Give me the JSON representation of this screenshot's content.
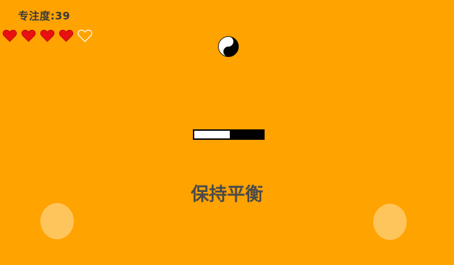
{
  "hud": {
    "focus_label": "专注度:",
    "focus_value": "39"
  },
  "lives": {
    "total": 5,
    "remaining": 4,
    "full_color": "#E81010",
    "empty_color": "#FFFFFF"
  },
  "balance": {
    "level": 0.5,
    "fill_color": "#FFFFFF",
    "track_color": "#000000"
  },
  "instruction": "保持平衡",
  "icons": {
    "center": "yin-yang-icon"
  },
  "colors": {
    "background": "#FFA300",
    "text": "#4A4A4A"
  }
}
